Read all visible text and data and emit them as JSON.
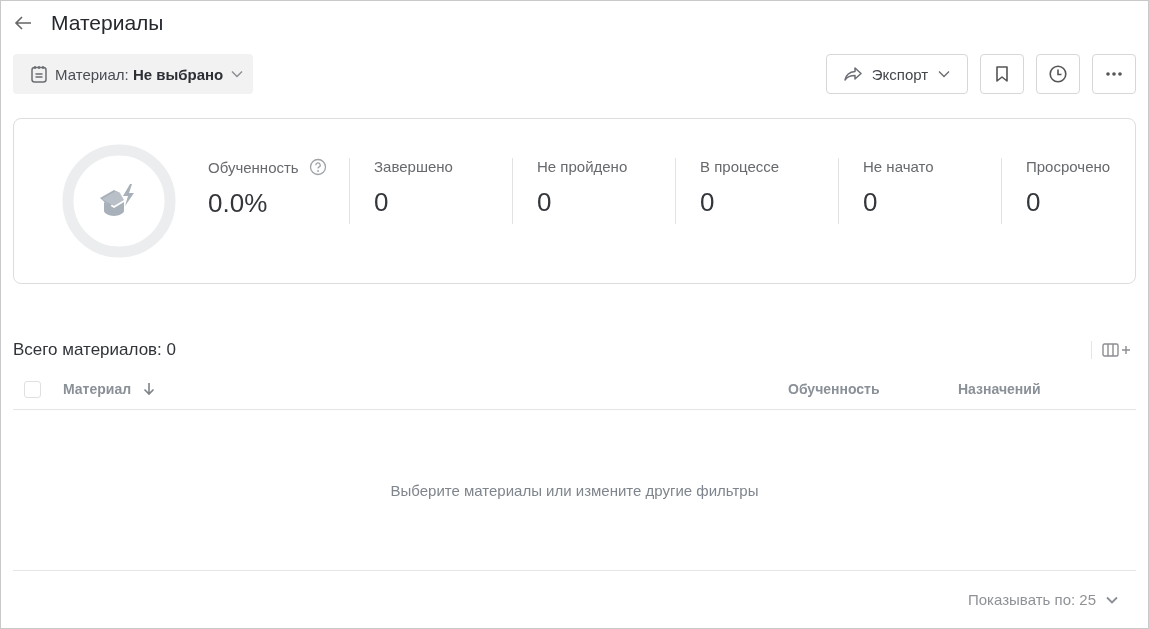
{
  "header": {
    "title": "Материалы"
  },
  "filter": {
    "label": "Материал: **Не выбрано**"
  },
  "toolbar": {
    "export_label": "Экспорт"
  },
  "summary": {
    "stats": [
      {
        "label": "Обученность",
        "value": "0.0%",
        "help": true
      },
      {
        "label": "Завершено",
        "value": "0",
        "help": false
      },
      {
        "label": "Не пройдено",
        "value": "0",
        "help": false
      },
      {
        "label": "В процессе",
        "value": "0",
        "help": false
      },
      {
        "label": "Не начато",
        "value": "0",
        "help": false
      },
      {
        "label": "Просрочено",
        "value": "0",
        "help": false
      }
    ]
  },
  "table": {
    "title": "Всего материалов: 0",
    "select_all": {
      "checked": false
    },
    "columns": [
      {
        "label": "Материал",
        "sorted": true
      },
      {
        "label": "Обученность",
        "sorted": false
      },
      {
        "label": "Назначений",
        "sorted": false
      }
    ],
    "empty_message": "Выберите материалы или измените другие фильтры"
  },
  "pagination": {
    "label": "Показывать по: 25"
  }
}
